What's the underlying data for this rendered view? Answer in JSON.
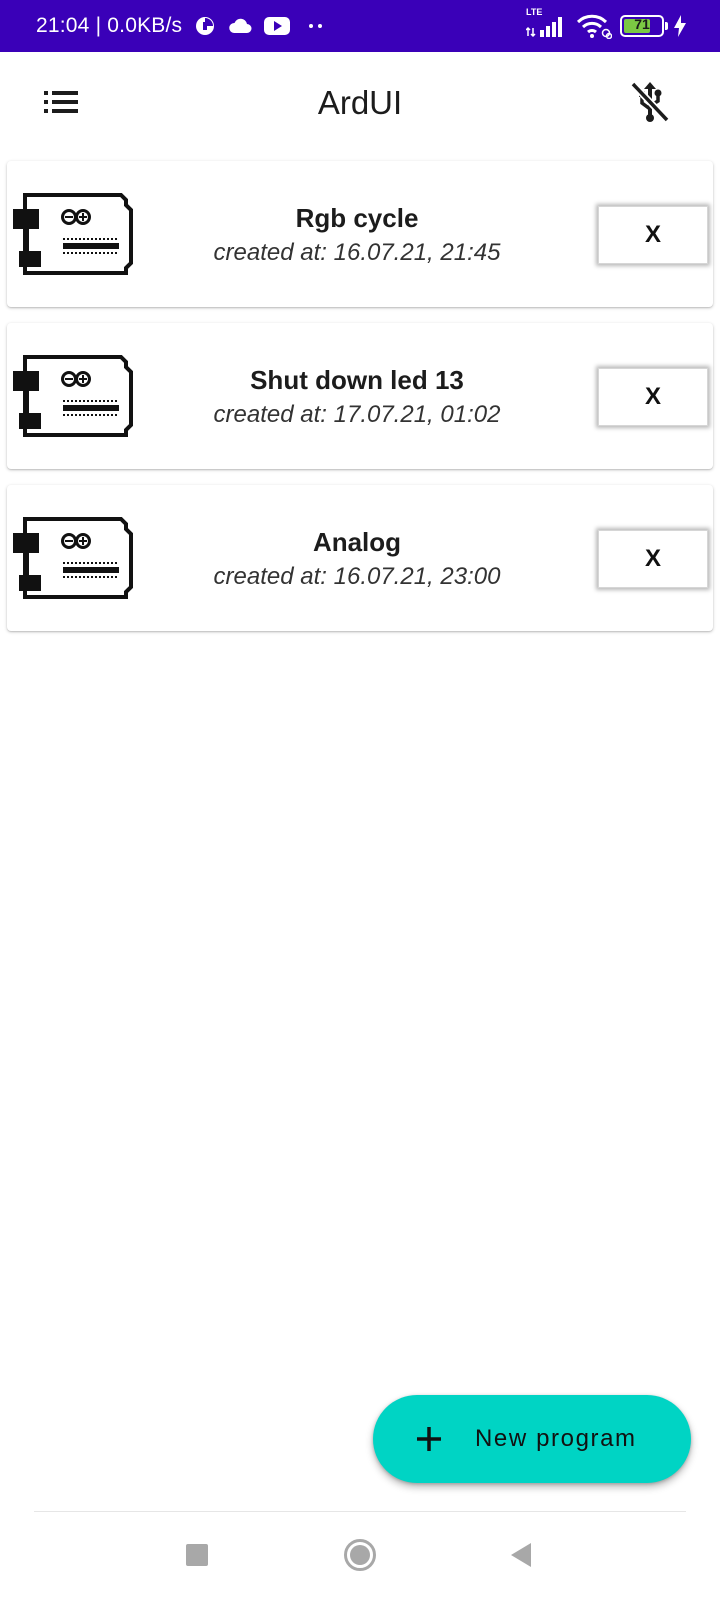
{
  "status_bar": {
    "time_speed": "21:04 | 0.0KB/s",
    "network_label": "LTE",
    "battery_level": "71",
    "battery_fraction": 0.71,
    "icons": [
      "data-saver-icon",
      "cloud-icon",
      "youtube-icon",
      "more-dots-icon",
      "signal-icon",
      "wifi-icon",
      "battery-icon",
      "charging-icon"
    ]
  },
  "app_bar": {
    "title": "ArdUI",
    "menu_icon": "list-menu-icon",
    "usb_icon": "usb-off-icon"
  },
  "programs": [
    {
      "name": "Rgb cycle",
      "created": "created at: 16.07.21, 21:45",
      "delete_label": "X"
    },
    {
      "name": "Shut down led 13",
      "created": "created at: 17.07.21, 01:02",
      "delete_label": "X"
    },
    {
      "name": "Analog",
      "created": "created at: 16.07.21, 23:00",
      "delete_label": "X"
    }
  ],
  "fab": {
    "label": "New program",
    "icon": "plus-icon"
  },
  "nav_bar": {
    "icons": [
      "recents-square-icon",
      "home-circle-icon",
      "back-triangle-icon"
    ]
  },
  "colors": {
    "status_bar": "#3a00b8",
    "fab": "#00d4c4",
    "battery_fill": "#7bc843",
    "text": "#1c1c1c"
  }
}
